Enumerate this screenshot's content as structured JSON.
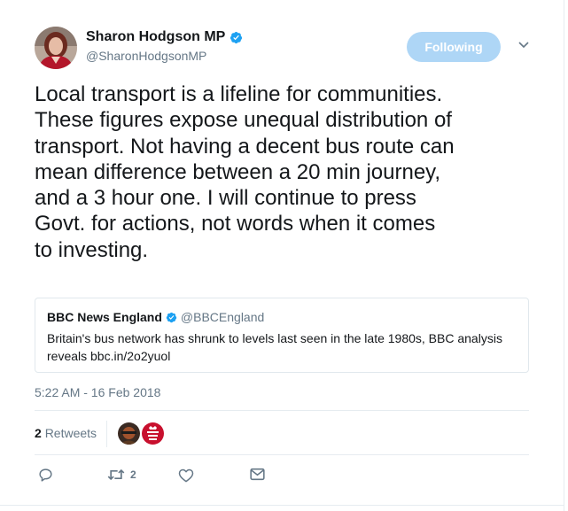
{
  "author": {
    "name": "Sharon Hodgson MP",
    "handle": "@SharonHodgsonMP",
    "verified": true
  },
  "follow_button": {
    "label": "Following"
  },
  "tweet": {
    "text": "Local transport is a lifeline for communities.\nThese figures expose unequal distribution of\ntransport. Not having a decent bus route can\nmean difference between a 20 min journey,\nand a 3 hour one. I will continue to press\nGovt. for actions, not words when it comes\nto investing.",
    "timestamp": "5:22 AM - 16 Feb 2018"
  },
  "quoted_tweet": {
    "name": "BBC News England",
    "handle": "@BBCEngland",
    "verified": true,
    "text": "Britain's bus network has shrunk to levels last seen in the late 1980s, BBC analysis reveals bbc.in/2o2yuol"
  },
  "stats": {
    "retweet_count": "2",
    "retweet_label": "Retweets"
  },
  "actions": {
    "retweet_count": "2"
  },
  "colors": {
    "accent": "#1da1f2",
    "follow_button_bg": "#aed6f6",
    "secondary_text": "#657786",
    "border": "#e1e8ed"
  },
  "icons": [
    "verified-badge-icon",
    "chevron-down-icon",
    "reply-icon",
    "retweet-icon",
    "like-icon",
    "direct-message-icon"
  ]
}
